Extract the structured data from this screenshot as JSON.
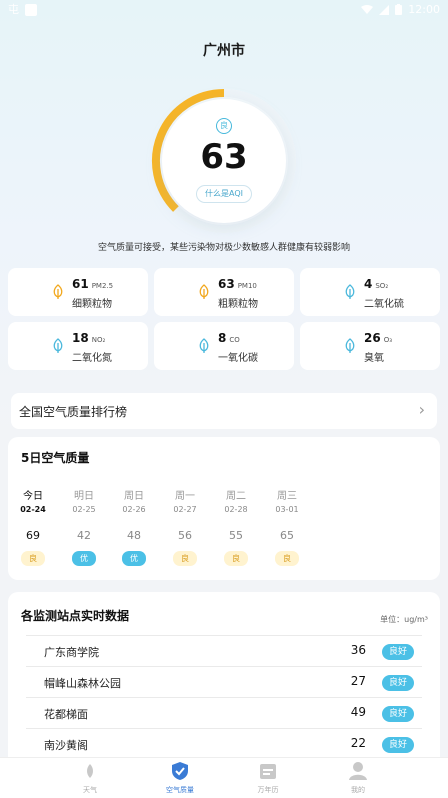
{
  "status": {
    "time": "12:00",
    "carrier_glyph": "屯"
  },
  "city": "广州市",
  "aqi": {
    "level": "良",
    "value": "63",
    "link": "什么是AQI"
  },
  "description": "空气质量可接受，某些污染物对极少数敏感人群健康有较弱影响",
  "pollutants": [
    {
      "value": "61",
      "sub": "PM2.5",
      "name": "细颗粒物"
    },
    {
      "value": "63",
      "sub": "PM10",
      "name": "粗颗粒物"
    },
    {
      "value": "4",
      "sub": "SO₂",
      "name": "二氧化硫"
    },
    {
      "value": "18",
      "sub": "NO₂",
      "name": "二氧化氮"
    },
    {
      "value": "8",
      "sub": "CO",
      "name": "一氧化碳"
    },
    {
      "value": "26",
      "sub": "O₃",
      "name": "臭氧"
    }
  ],
  "ranking": {
    "label": "全国空气质量排行榜",
    "arrow": "›"
  },
  "forecast": {
    "title": "5日空气质量",
    "days": [
      {
        "name": "今日",
        "date": "02-24",
        "value": "69",
        "level": "良"
      },
      {
        "name": "明日",
        "date": "02-25",
        "value": "42",
        "level": "优"
      },
      {
        "name": "周日",
        "date": "02-26",
        "value": "48",
        "level": "优"
      },
      {
        "name": "周一",
        "date": "02-27",
        "value": "56",
        "level": "良"
      },
      {
        "name": "周二",
        "date": "02-28",
        "value": "55",
        "level": "良"
      },
      {
        "name": "周三",
        "date": "03-01",
        "value": "65",
        "level": "良"
      }
    ]
  },
  "stations": {
    "title": "各监测站点实时数据",
    "unit": "单位：ug/m³",
    "rows": [
      {
        "name": "广东商学院",
        "value": "36",
        "level": "良好"
      },
      {
        "name": "帽峰山森林公园",
        "value": "27",
        "level": "良好"
      },
      {
        "name": "花都梯面",
        "value": "49",
        "level": "良好"
      },
      {
        "name": "南沙黄阁",
        "value": "22",
        "level": "良好"
      }
    ]
  },
  "tabs": [
    {
      "label": "天气",
      "icon": "weather-icon"
    },
    {
      "label": "空气质量",
      "icon": "air-quality-icon"
    },
    {
      "label": "万年历",
      "icon": "calendar-icon"
    },
    {
      "label": "我的",
      "icon": "profile-icon"
    }
  ],
  "colors": {
    "accent": "#4bc0e6",
    "gauge": "#f7b526",
    "active_tab": "#3a7bd5"
  }
}
